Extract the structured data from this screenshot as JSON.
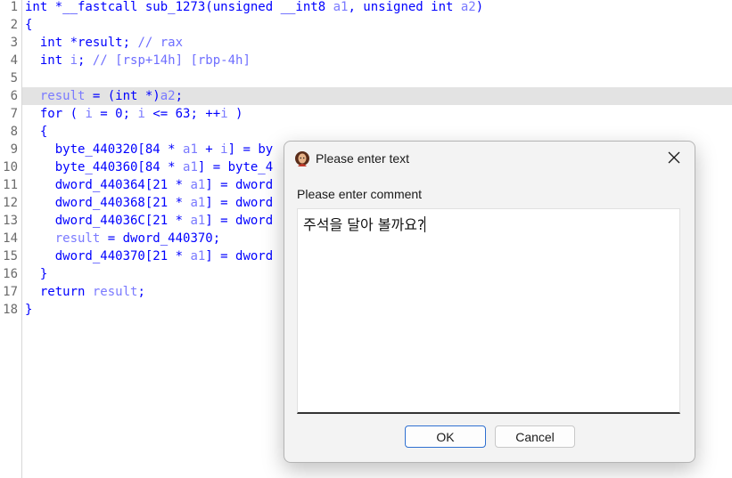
{
  "code": {
    "lines": [
      {
        "num": "1",
        "text": "int *__fastcall sub_1273(unsigned __int8 a1, unsigned int a2)"
      },
      {
        "num": "2",
        "text": "{"
      },
      {
        "num": "3",
        "text": "  int *result; // rax"
      },
      {
        "num": "4",
        "text": "  int i; // [rsp+14h] [rbp-4h]"
      },
      {
        "num": "5",
        "text": ""
      },
      {
        "num": "6",
        "text": "  result = (int *)a2;"
      },
      {
        "num": "7",
        "text": "  for ( i = 0; i <= 63; ++i )"
      },
      {
        "num": "8",
        "text": "  {"
      },
      {
        "num": "9",
        "text": "    byte_440320[84 * a1 + i] = by"
      },
      {
        "num": "10",
        "text": "    byte_440360[84 * a1] = byte_4"
      },
      {
        "num": "11",
        "text": "    dword_440364[21 * a1] = dword"
      },
      {
        "num": "12",
        "text": "    dword_440368[21 * a1] = dword"
      },
      {
        "num": "13",
        "text": "    dword_44036C[21 * a1] = dword"
      },
      {
        "num": "14",
        "text": "    result = dword_440370;"
      },
      {
        "num": "15",
        "text": "    dword_440370[21 * a1] = dword"
      },
      {
        "num": "16",
        "text": "  }"
      },
      {
        "num": "17",
        "text": "  return result;"
      },
      {
        "num": "18",
        "text": "}"
      }
    ],
    "highlighted_line": "6"
  },
  "dialog": {
    "title": "Please enter text",
    "app_icon": "app-avatar-icon",
    "close_icon": "close-icon",
    "prompt": "Please enter comment",
    "comment_value": "주석을 달아 볼까요?",
    "ok_label": "OK",
    "cancel_label": "Cancel"
  }
}
